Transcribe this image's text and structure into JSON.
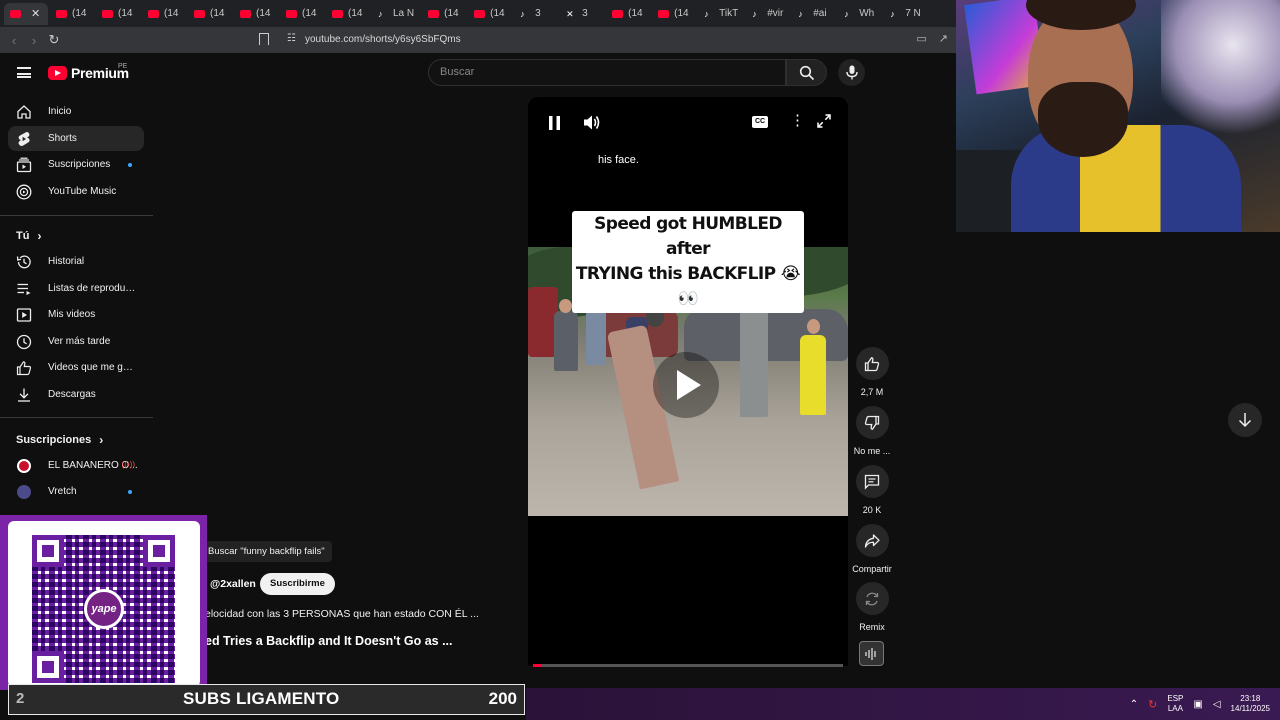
{
  "browser": {
    "tabs": [
      {
        "label": "",
        "type": "yt",
        "active": true
      },
      {
        "label": "(14",
        "type": "yt"
      },
      {
        "label": "(14",
        "type": "yt"
      },
      {
        "label": "(14",
        "type": "yt"
      },
      {
        "label": "(14",
        "type": "yt"
      },
      {
        "label": "(14",
        "type": "yt"
      },
      {
        "label": "(14",
        "type": "yt"
      },
      {
        "label": "(14",
        "type": "yt"
      },
      {
        "label": "La N",
        "type": "tt"
      },
      {
        "label": "(14",
        "type": "yt"
      },
      {
        "label": "(14",
        "type": "yt"
      },
      {
        "label": "3",
        "type": "tt"
      },
      {
        "label": "3",
        "type": "x"
      },
      {
        "label": "(14",
        "type": "yt"
      },
      {
        "label": "(14",
        "type": "yt"
      },
      {
        "label": "TikT",
        "type": "tt"
      },
      {
        "label": "#vir",
        "type": "tt"
      },
      {
        "label": "#ai",
        "type": "tt"
      },
      {
        "label": "Wh",
        "type": "tt"
      },
      {
        "label": "7 N",
        "type": "tt"
      }
    ],
    "url": "youtube.com/shorts/y6sy6SbFQms"
  },
  "masthead": {
    "logo_text": "Premium",
    "country": "PE",
    "search_placeholder": "Buscar"
  },
  "sidebar": {
    "main": [
      {
        "label": "Inicio",
        "icon": "home-icon"
      },
      {
        "label": "Shorts",
        "icon": "shorts-icon",
        "active": true
      },
      {
        "label": "Suscripciones",
        "icon": "subscriptions-icon",
        "dot": true
      },
      {
        "label": "YouTube Music",
        "icon": "youtube-music-icon"
      }
    ],
    "you_title": "Tú",
    "you": [
      {
        "label": "Historial",
        "icon": "history-icon"
      },
      {
        "label": "Listas de reproducc...",
        "icon": "playlists-icon"
      },
      {
        "label": "Mis videos",
        "icon": "my-videos-icon"
      },
      {
        "label": "Ver más tarde",
        "icon": "watch-later-icon"
      },
      {
        "label": "Videos que me gus...",
        "icon": "liked-videos-icon"
      },
      {
        "label": "Descargas",
        "icon": "downloads-icon"
      }
    ],
    "subs_title": "Suscripciones",
    "subs": [
      {
        "label": "EL BANANERO O...",
        "live": "((•))",
        "color": "#c8102e"
      },
      {
        "label": "Vretch",
        "dot": true,
        "color": "#3b3b6a"
      }
    ]
  },
  "player": {
    "caption": "his face.",
    "overlay_line1": "Speed got HUMBLED after",
    "overlay_line2": "TRYING this BACKFLIP 😭👀",
    "cc_label": "CC",
    "progress": 0.03
  },
  "actions": {
    "likes": "2,7 M",
    "dislike": "No me ...",
    "comments": "20 K",
    "share": "Compartir",
    "remix": "Remix"
  },
  "info": {
    "search_chip": "Buscar \"funny backflip fails\"",
    "channel": "@2xallen",
    "subscribe": "Suscribirme",
    "description": "elocidad con las 3 PERSONAS que han estado CON ÉL ...",
    "title": "ed Tries a Backflip and It Doesn't Go as ..."
  },
  "overlay": {
    "qr_brand": "yape",
    "goal_current": "2",
    "goal_label": "SUBS LIGAMENTO",
    "goal_target": "200"
  },
  "taskbar": {
    "lang1": "ESP",
    "lang2": "LAA",
    "time": "23:18",
    "date": "14/11/2025"
  }
}
